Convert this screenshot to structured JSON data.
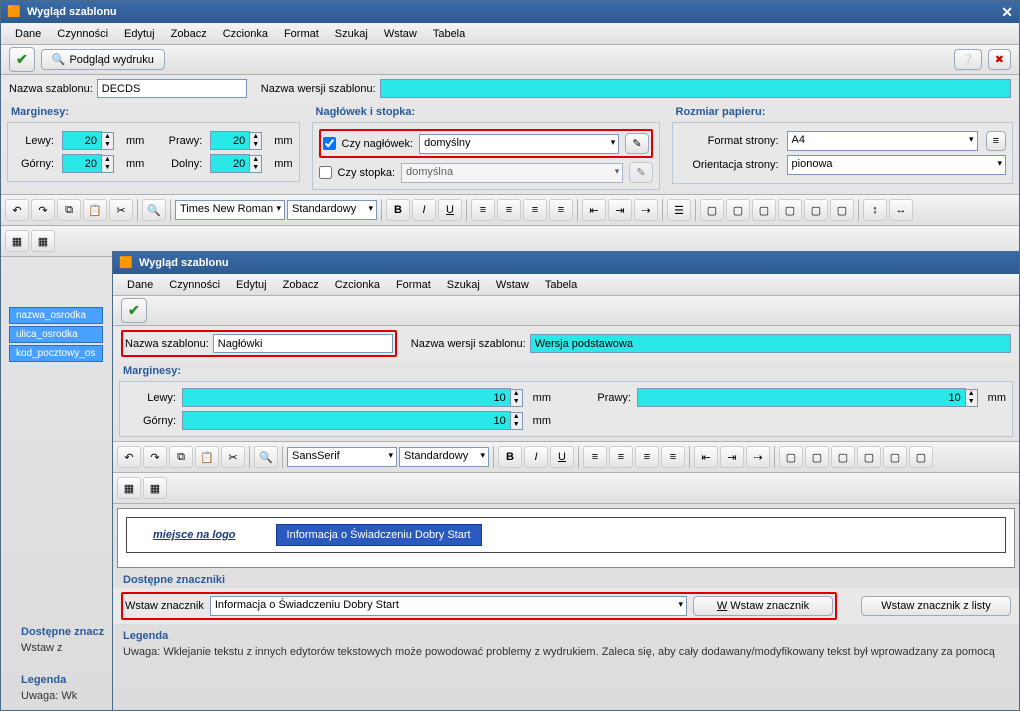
{
  "main": {
    "title": "Wygląd szablonu",
    "menu": [
      "Dane",
      "Czynności",
      "Edytuj",
      "Zobacz",
      "Czcionka",
      "Format",
      "Szukaj",
      "Wstaw",
      "Tabela"
    ],
    "toolbar": {
      "preview": "Podgląd wydruku"
    },
    "name_label": "Nazwa szablonu:",
    "name_value": "DECDS",
    "version_label": "Nazwa wersji szablonu:",
    "version_value": "",
    "margins_title": "Marginesy:",
    "margin_unit": "mm",
    "margins": {
      "left_label": "Lewy:",
      "left": "20",
      "right_label": "Prawy:",
      "right": "20",
      "top_label": "Górny:",
      "top": "20",
      "bottom_label": "Dolny:",
      "bottom": "20"
    },
    "header_title": "Nagłówek i stopka:",
    "header_check": "Czy nagłówek:",
    "header_select": "domyślny",
    "footer_check": "Czy stopka:",
    "footer_select": "domyślna",
    "paper_title": "Rozmiar papieru:",
    "format_label": "Format strony:",
    "format_value": "A4",
    "orient_label": "Orientacja strony:",
    "orient_value": "pionowa",
    "font": "Times New Roman",
    "style": "Standardowy",
    "available_markers": "Dostępne znacz",
    "insert_label": "Wstaw z",
    "legend_title": "Legenda",
    "legend_note": "Uwaga: Wk",
    "tags": [
      "nazwa_osrodka",
      "ulica_osrodka",
      "kod_pocztowy_os"
    ]
  },
  "child": {
    "title": "Wygląd szablonu",
    "menu": [
      "Dane",
      "Czynności",
      "Edytuj",
      "Zobacz",
      "Czcionka",
      "Format",
      "Szukaj",
      "Wstaw",
      "Tabela"
    ],
    "name_label": "Nazwa szablonu:",
    "name_value": "Nagłówki",
    "version_label": "Nazwa wersji szablonu:",
    "version_value": "Wersja podstawowa",
    "margins_title": "Marginesy:",
    "margins": {
      "left_label": "Lewy:",
      "left": "10",
      "right_label": "Prawy:",
      "right": "10",
      "top_label": "Górny:",
      "top": "10"
    },
    "font": "SansSerif",
    "style": "Standardowy",
    "logo_placeholder": "miejsce na logo",
    "info_tag": "Informacja o Świadczeniu Dobry Start",
    "avail_title": "Dostępne znaczniki",
    "insert_marker_label": "Wstaw znacznik",
    "marker_value": "Informacja o Świadczeniu Dobry Start",
    "insert_btn": "Wstaw znacznik",
    "insert_list_btn": "Wstaw znacznik z listy",
    "legend_title": "Legenda",
    "legend_text": "Uwaga: Wklejanie tekstu z innych edytorów tekstowych może powodować problemy z wydrukiem. Zaleca się, aby cały dodawany/modyfikowany tekst był wprowadzany za pomocą"
  }
}
